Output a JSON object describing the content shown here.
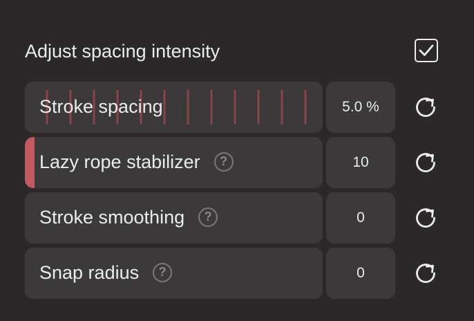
{
  "header": {
    "label": "Adjust spacing intensity",
    "checked": true,
    "checkbox_icon": "checkmark-icon"
  },
  "rows": [
    {
      "label": "Stroke spacing",
      "value": "5.0 %",
      "has_help": false,
      "help_glyph": "?",
      "reset_icon": "reset-icon",
      "show_ticks": true,
      "handle_visible": false
    },
    {
      "label": "Lazy rope stabilizer",
      "value": "10",
      "has_help": true,
      "help_glyph": "?",
      "reset_icon": "reset-icon",
      "show_ticks": false,
      "handle_visible": true
    },
    {
      "label": "Stroke smoothing",
      "value": "0",
      "has_help": true,
      "help_glyph": "?",
      "reset_icon": "reset-icon",
      "show_ticks": false,
      "handle_visible": false
    },
    {
      "label": "Snap radius",
      "value": "0",
      "has_help": true,
      "help_glyph": "?",
      "reset_icon": "reset-icon",
      "show_ticks": false,
      "handle_visible": false
    }
  ],
  "colors": {
    "background": "#2a2829",
    "control_fill": "#3b393a",
    "accent": "#c05a5e",
    "tick": "#8a4447",
    "text": "#ececec",
    "help_icon": "#7a7879"
  }
}
